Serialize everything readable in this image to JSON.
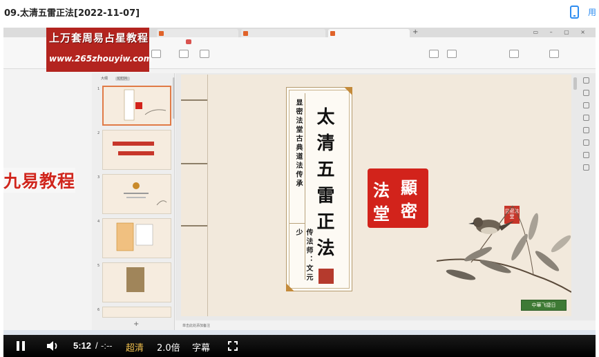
{
  "page": {
    "title": "09.太清五雷正法[2022-11-07]",
    "app_label": "用"
  },
  "watermark": {
    "logo_line1": "上万套周易占星教程",
    "logo_line2": "www.265zhouyiw.com",
    "overlay": "九易教程"
  },
  "slide": {
    "side_column": "显密法堂古典道法传承",
    "title": "太清五雷正法",
    "teacher": "传法师：文元少",
    "seal_big": [
      "法",
      "堂",
      "顯",
      "密"
    ],
    "seal_small": "显密法堂",
    "seal_green": "中華飞捷日",
    "note": "单击此处添加备注"
  },
  "editor_panel": {
    "tab_outline": "大纲",
    "tab_slides": "幻灯片"
  },
  "controls": {
    "time_current": "5:12",
    "time_separator": "/",
    "time_duration": "-:--",
    "quality": "超清",
    "speed": "2.0倍",
    "subtitles": "字幕"
  }
}
